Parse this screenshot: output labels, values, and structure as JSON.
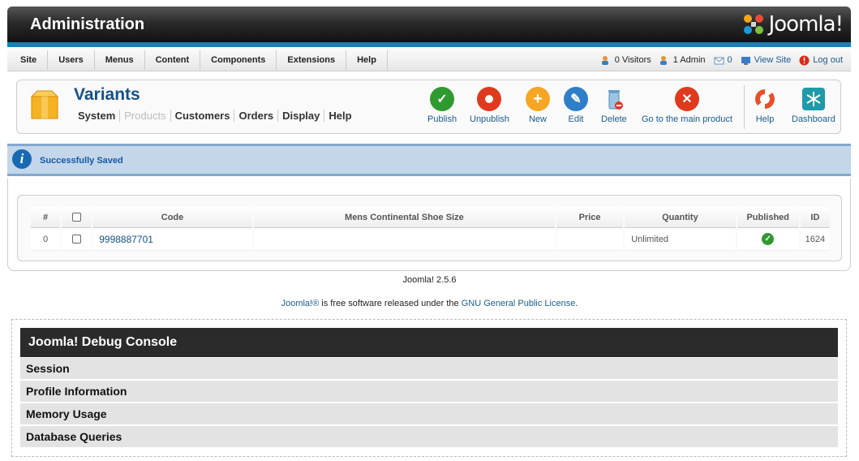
{
  "header": {
    "title": "Administration",
    "logo_text": "Joomla!"
  },
  "menu": [
    "Site",
    "Users",
    "Menus",
    "Content",
    "Components",
    "Extensions",
    "Help"
  ],
  "status": {
    "visitors": "0 Visitors",
    "admins": "1 Admin",
    "messages": "0",
    "view_site": "View Site",
    "logout": "Log out"
  },
  "toolbar": {
    "title": "Variants",
    "subnav": [
      "System",
      "Products",
      "Customers",
      "Orders",
      "Display",
      "Help"
    ],
    "buttons": {
      "publish": "Publish",
      "unpublish": "Unpublish",
      "new": "New",
      "edit": "Edit",
      "delete": "Delete",
      "goto_main": "Go to the main product",
      "help": "Help",
      "dashboard": "Dashboard"
    }
  },
  "message": {
    "text": "Successfully Saved"
  },
  "table": {
    "headers": [
      "#",
      "",
      "Code",
      "Mens Continental Shoe Size",
      "Price",
      "Quantity",
      "Published",
      "ID"
    ],
    "rows": [
      {
        "num": "0",
        "code": "9998887701",
        "size": "",
        "price": "",
        "quantity": "Unlimited",
        "published": true,
        "id": "1624"
      }
    ]
  },
  "footer": {
    "version": "Joomla! 2.5.6",
    "license_link1": "Joomla!®",
    "license_text": " is free software released under the ",
    "license_link2": "GNU General Public License",
    "license_end": "."
  },
  "debug": {
    "title": "Joomla! Debug Console",
    "sections": [
      "Session",
      "Profile Information",
      "Memory Usage",
      "Database Queries"
    ]
  },
  "colors": {
    "accent_blue": "#1a7fb8",
    "link": "#1a5c8f",
    "publish_green": "#2f9a2f",
    "unpublish_red": "#e03a1e",
    "new_orange": "#f5a623",
    "delete_red": "#d93a2b"
  }
}
